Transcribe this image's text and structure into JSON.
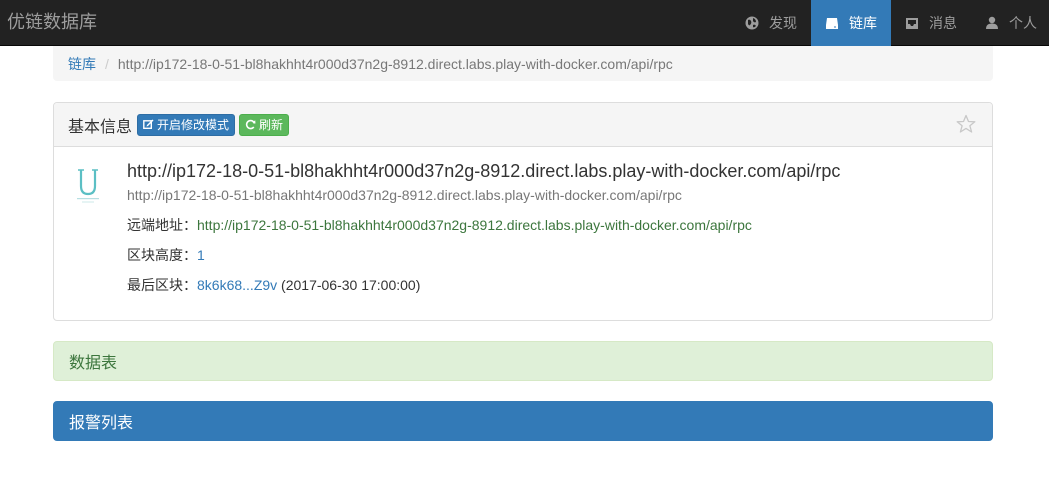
{
  "navbar": {
    "brand": "优链数据库",
    "items": [
      {
        "label": "发现",
        "icon": "globe-icon",
        "active": false
      },
      {
        "label": "链库",
        "icon": "hdd-icon",
        "active": true
      },
      {
        "label": "消息",
        "icon": "inbox-icon",
        "active": false
      },
      {
        "label": "个人",
        "icon": "user-icon",
        "active": false
      }
    ]
  },
  "breadcrumb": {
    "home": "链库",
    "current": "http://ip172-18-0-51-bl8hakhht4r000d37n2g-8912.direct.labs.play-with-docker.com/api/rpc"
  },
  "panel": {
    "title": "基本信息",
    "edit_button": "开启修改模式",
    "refresh_button": "刷新",
    "star_icon": "star-empty-icon",
    "chain": {
      "name": "http://ip172-18-0-51-bl8hakhht4r000d37n2g-8912.direct.labs.play-with-docker.com/api/rpc",
      "url": "http://ip172-18-0-51-bl8hakhht4r000d37n2g-8912.direct.labs.play-with-docker.com/api/rpc",
      "remote_label": "远端地址：",
      "remote_value": "http://ip172-18-0-51-bl8hakhht4r000d37n2g-8912.direct.labs.play-with-docker.com/api/rpc",
      "height_label": "区块高度：",
      "height_value": "1",
      "last_block_label": "最后区块：",
      "last_block_hash": "8k6k68...Z9v",
      "last_block_time": " (2017-06-30 17:00:00)"
    }
  },
  "sections": {
    "tables": "数据表",
    "alerts": "报警列表"
  },
  "colors": {
    "navbar_bg": "#222222",
    "accent": "#337ab7",
    "success_bg": "#dff0d8",
    "success_text": "#3c763d",
    "refresh_btn": "#5cb85c"
  }
}
